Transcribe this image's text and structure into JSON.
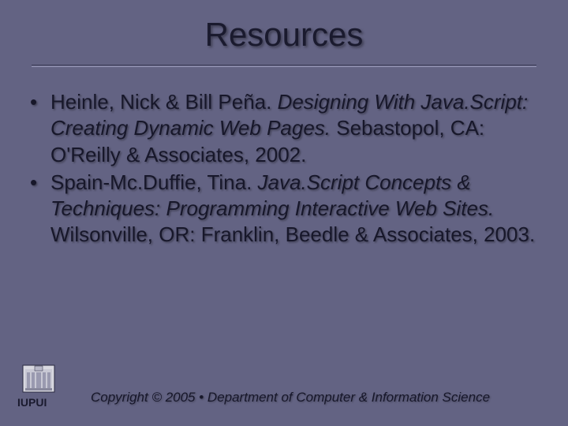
{
  "title": "Resources",
  "bullets": [
    {
      "author": "Heinle, Nick & Bill Peña. ",
      "book_title": "Designing With Java.Script: Creating Dynamic Web Pages.",
      "rest": " Sebastopol, CA: O'Reilly & Associates, 2002."
    },
    {
      "author": "Spain-Mc.Duffie, Tina. ",
      "book_title": "Java.Script Concepts & Techniques: Programming Interactive Web Sites.",
      "rest": " Wilsonville, OR: Franklin, Beedle & Associates, 2003."
    }
  ],
  "footer": {
    "copyright": "Copyright © 2005 • Department of Computer & Information Science",
    "org": "IUPUI"
  }
}
